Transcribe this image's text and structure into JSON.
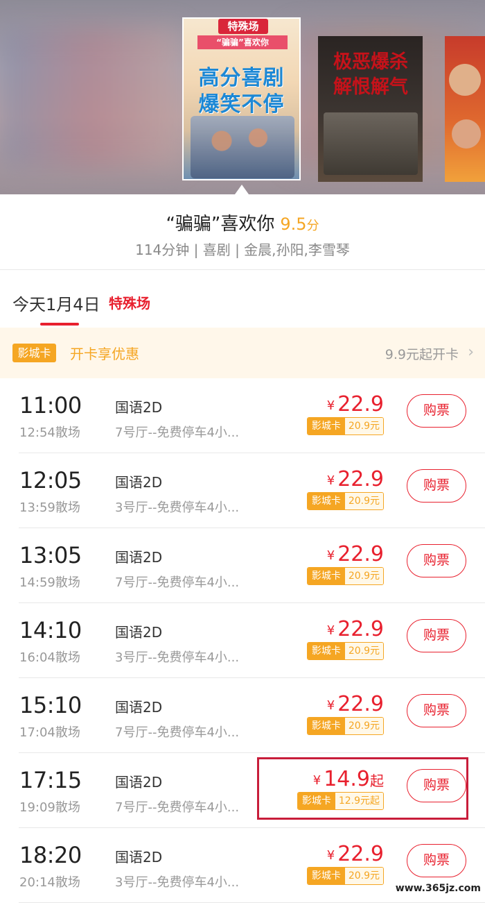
{
  "banner": {
    "main_poster": {
      "tag": "特殊场",
      "subtitle": "“骗骗”喜欢你",
      "headline_line1": "高分喜剧",
      "headline_line2": "爆笑不停"
    },
    "second_poster": {
      "title_line1": "极恶爆杀",
      "title_line2": "解恨解气"
    },
    "third_poster": {}
  },
  "movie": {
    "title": "“骗骗”喜欢你",
    "score": "9.5",
    "score_unit": "分",
    "meta": "114分钟 | 喜剧 | 金晨,孙阳,李雪琴"
  },
  "date_tab": {
    "date": "今天1月4日",
    "special": "特殊场"
  },
  "promo": {
    "badge": "影城卡",
    "text": "开卡享优惠",
    "right_text": "9.9元起开卡",
    "chevron": "›"
  },
  "showtimes": [
    {
      "time": "11:00",
      "end": "12:54散场",
      "lang": "国语2D",
      "hall": "7号厅--免费停车4小...",
      "yen": "¥",
      "price": "22.9",
      "qi": "",
      "card_label": "影城卡",
      "card_price": "20.9元",
      "buy": "购票"
    },
    {
      "time": "12:05",
      "end": "13:59散场",
      "lang": "国语2D",
      "hall": "3号厅--免费停车4小...",
      "yen": "¥",
      "price": "22.9",
      "qi": "",
      "card_label": "影城卡",
      "card_price": "20.9元",
      "buy": "购票"
    },
    {
      "time": "13:05",
      "end": "14:59散场",
      "lang": "国语2D",
      "hall": "7号厅--免费停车4小...",
      "yen": "¥",
      "price": "22.9",
      "qi": "",
      "card_label": "影城卡",
      "card_price": "20.9元",
      "buy": "购票"
    },
    {
      "time": "14:10",
      "end": "16:04散场",
      "lang": "国语2D",
      "hall": "3号厅--免费停车4小...",
      "yen": "¥",
      "price": "22.9",
      "qi": "",
      "card_label": "影城卡",
      "card_price": "20.9元",
      "buy": "购票"
    },
    {
      "time": "15:10",
      "end": "17:04散场",
      "lang": "国语2D",
      "hall": "7号厅--免费停车4小...",
      "yen": "¥",
      "price": "22.9",
      "qi": "",
      "card_label": "影城卡",
      "card_price": "20.9元",
      "buy": "购票"
    },
    {
      "time": "17:15",
      "end": "19:09散场",
      "lang": "国语2D",
      "hall": "7号厅--免费停车4小...",
      "yen": "¥",
      "price": "14.9",
      "qi": "起",
      "card_label": "影城卡",
      "card_price": "12.9元起",
      "buy": "购票"
    },
    {
      "time": "18:20",
      "end": "20:14散场",
      "lang": "国语2D",
      "hall": "3号厅--免费停车4小...",
      "yen": "¥",
      "price": "22.9",
      "qi": "",
      "card_label": "影城卡",
      "card_price": "20.9元",
      "buy": "购票"
    }
  ],
  "watermark": "www.365jz.com",
  "colors": {
    "accent_red": "#e8202e",
    "card_orange": "#f5a623",
    "highlight_border": "#c81d3a"
  }
}
